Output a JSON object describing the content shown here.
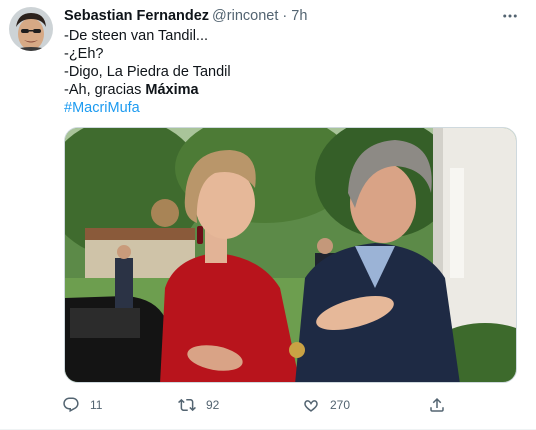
{
  "author": {
    "name": "Sebastian Fernandez",
    "handle": "@rinconet",
    "separator": "·",
    "time": "7h"
  },
  "tweet": {
    "line1": "-De steen van Tandil...",
    "line2": "-¿Eh?",
    "line3": "-Digo, La Piedra de Tandil",
    "line4_prefix": "-Ah, gracias ",
    "line4_bold": "Máxima",
    "hashtag": "#MacriMufa"
  },
  "actions": {
    "replies": "11",
    "retweets": "92",
    "likes": "270"
  },
  "icons": {
    "more": "more-horizontal-icon",
    "reply": "reply-icon",
    "retweet": "retweet-icon",
    "like": "heart-icon",
    "share": "share-icon"
  },
  "colors": {
    "text": "#0f1419",
    "secondary": "#536471",
    "link": "#1d9bf0",
    "border": "#cfd9de"
  }
}
